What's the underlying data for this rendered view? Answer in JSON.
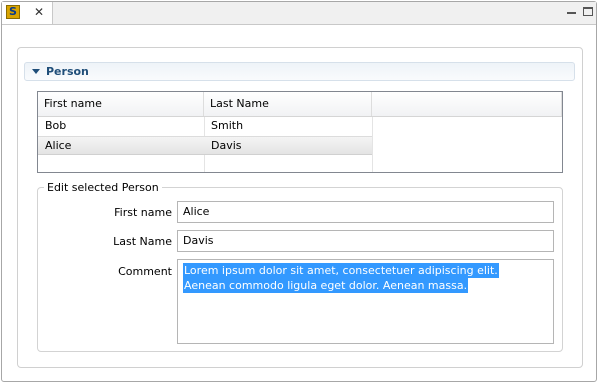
{
  "section": {
    "title": "Person"
  },
  "table": {
    "columns": [
      "First name",
      "Last Name"
    ],
    "rows": [
      {
        "first": "Bob",
        "last": "Smith"
      },
      {
        "first": "Alice",
        "last": "Davis"
      }
    ]
  },
  "edit": {
    "legend": "Edit selected Person",
    "first_name_label": "First name",
    "first_name_value": "Alice",
    "last_name_label": "Last Name",
    "last_name_value": "Davis",
    "comment_label": "Comment",
    "comment_lines": [
      "Lorem ipsum dolor sit amet, consectetuer adipiscing elit.",
      "Aenean commodo ligula eget dolor. Aenean massa."
    ]
  },
  "icons": {
    "tab_icon": "app-s-icon",
    "close": "close-icon",
    "minimize": "minimize-icon",
    "maximize": "maximize-icon",
    "collapse": "chevron-down-icon"
  },
  "colors": {
    "section_title": "#1f4e79",
    "selection": "#3399ff"
  },
  "tab_glyph": "S"
}
